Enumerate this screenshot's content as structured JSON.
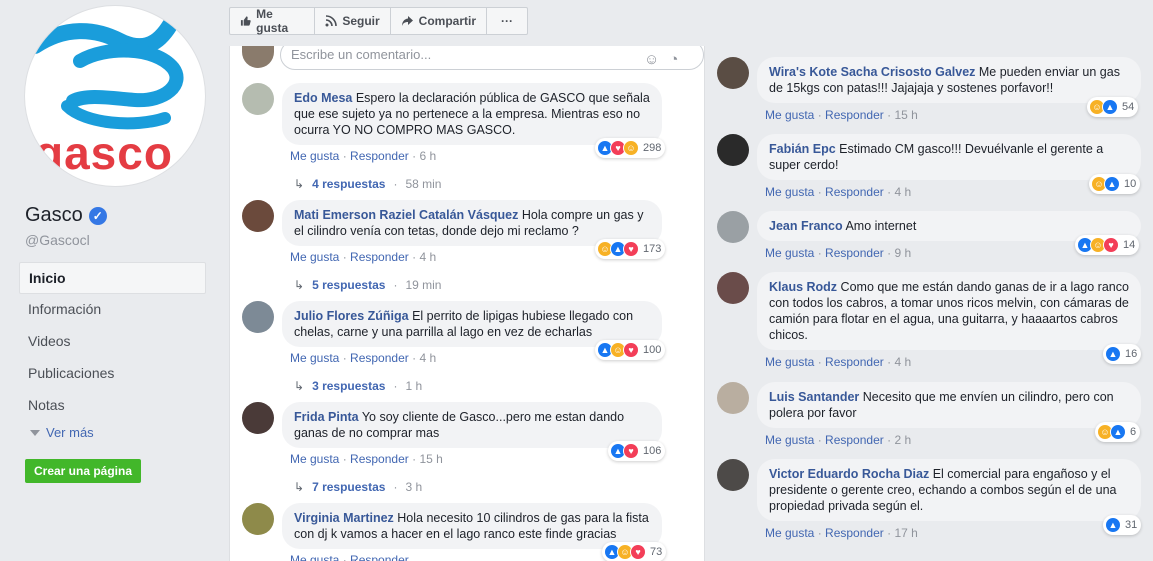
{
  "page": {
    "name": "Gasco",
    "handle": "@Gascocl",
    "logo_text": "gasco",
    "verified": true
  },
  "nav": {
    "items": [
      {
        "label": "Inicio",
        "active": true
      },
      {
        "label": "Información",
        "active": false
      },
      {
        "label": "Videos",
        "active": false
      },
      {
        "label": "Publicaciones",
        "active": false
      },
      {
        "label": "Notas",
        "active": false
      }
    ],
    "see_more": "Ver más",
    "create_page": "Crear una página"
  },
  "actions": {
    "like": "Me gusta",
    "follow": "Seguir",
    "share": "Compartir",
    "more": "···"
  },
  "composer": {
    "placeholder": "Escribe un comentario..."
  },
  "labels": {
    "like": "Me gusta",
    "reply": "Responder",
    "sep": "·"
  },
  "left_comments": [
    {
      "author": "Edo Mesa",
      "text": "Espero la declaración pública de GASCO que señala que ese sujeto ya no pertenece a la empresa. Mientras eso no ocurra YO NO COMPRO MAS GASCO.",
      "time": "6 h",
      "reactions": [
        "like",
        "love",
        "haha"
      ],
      "count": "298",
      "replies": "4 respuestas",
      "replies_time": "58 min"
    },
    {
      "author": "Mati Emerson Raziel Catalán Vásquez",
      "text": "Hola compre un gas y el cilindro venía con tetas, donde dejo mi reclamo ?",
      "time": "4 h",
      "reactions": [
        "haha",
        "like",
        "love"
      ],
      "count": "173",
      "replies": "5 respuestas",
      "replies_time": "19 min"
    },
    {
      "author": "Julio Flores Zúñiga",
      "text": "El perrito de lipigas hubiese llegado con chelas, carne y una parrilla al lago en vez de echarlas",
      "time": "4 h",
      "reactions": [
        "like",
        "haha",
        "love"
      ],
      "count": "100",
      "replies": "3 respuestas",
      "replies_time": "1 h"
    },
    {
      "author": "Frida Pinta",
      "text": "Yo soy cliente de Gasco...pero me estan dando ganas de no comprar mas",
      "time": "15 h",
      "reactions": [
        "like",
        "love"
      ],
      "count": "106",
      "replies": "7 respuestas",
      "replies_time": "3 h"
    },
    {
      "author": "Virginia Martinez",
      "text": "Hola necesito 10 cilindros de gas para la fista con dj k vamos a hacer en el lago ranco este finde gracias",
      "time": "",
      "reactions": [
        "like",
        "haha",
        "love"
      ],
      "count": "73",
      "replies": "",
      "replies_time": ""
    }
  ],
  "right_comments": [
    {
      "author": "Wira's Kote Sacha Crisosto Galvez",
      "text": "Me pueden enviar un gas de 15kgs con patas!!! Jajajaja y sostenes porfavor!!",
      "time": "15 h",
      "reactions": [
        "haha",
        "like"
      ],
      "count": "54"
    },
    {
      "author": "Fabián Epc",
      "text": "Estimado CM gasco!!! Devuélvanle el gerente a super cerdo!",
      "time": "4 h",
      "reactions": [
        "haha",
        "like"
      ],
      "count": "10"
    },
    {
      "author": "Jean Franco",
      "text": "Amo internet",
      "time": "9 h",
      "reactions": [
        "like",
        "haha",
        "love"
      ],
      "count": "14"
    },
    {
      "author": "Klaus Rodz",
      "text": "Como que me están dando ganas de ir a lago ranco con todos los cabros, a tomar unos ricos melvin, con cámaras de camión para flotar en el agua, una guitarra, y haaaartos cabros chicos.",
      "time": "4 h",
      "reactions": [
        "like"
      ],
      "count": "16"
    },
    {
      "author": "Luis Santander",
      "text": "Necesito que me envíen un cilindro, pero con polera por favor",
      "time": "2 h",
      "reactions": [
        "haha",
        "like"
      ],
      "count": "6"
    },
    {
      "author": "Victor Eduardo Rocha Diaz",
      "text": "El comercial para engañoso y el presidente o gerente creo, echando a combos según el de una propiedad privada según el.",
      "time": "17 h",
      "reactions": [
        "like"
      ],
      "count": "31"
    }
  ],
  "colors": {
    "link": "#385898",
    "meta_link": "#4267b2",
    "bubble": "#f2f3f5",
    "brand_blue": "#1a9ddb",
    "brand_red": "#e43c43",
    "create_green": "#42b72a"
  }
}
